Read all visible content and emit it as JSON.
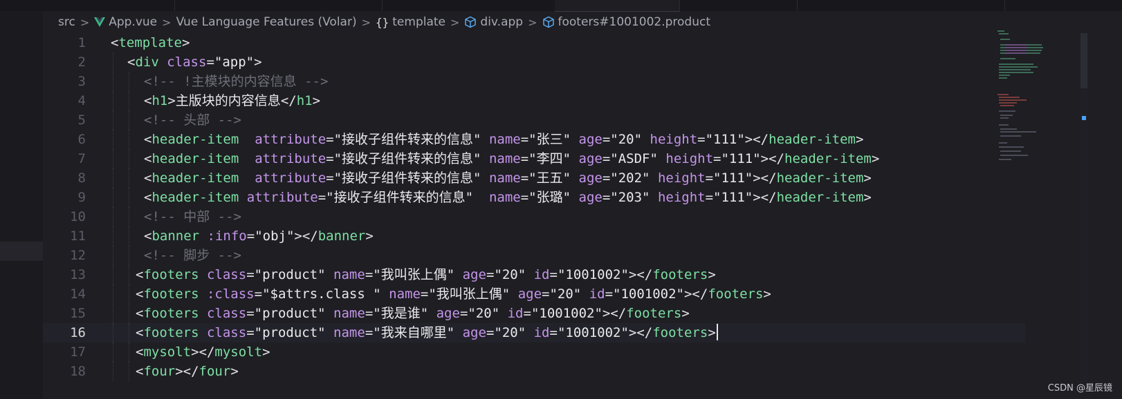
{
  "breadcrumb": {
    "items": [
      {
        "label": "src",
        "icon": null
      },
      {
        "label": "App.vue",
        "icon": "vue-logo-icon"
      },
      {
        "label": "Vue Language Features (Volar)",
        "icon": null
      },
      {
        "label": "template",
        "icon": "braces-icon"
      },
      {
        "label": "div.app",
        "icon": "cube-icon"
      },
      {
        "label": "footers#1001002.product",
        "icon": "cube-icon"
      }
    ],
    "separator": ">"
  },
  "editor": {
    "current_line": 16,
    "lines": [
      {
        "n": "1"
      },
      {
        "n": "2"
      },
      {
        "n": "3"
      },
      {
        "n": "4"
      },
      {
        "n": "5"
      },
      {
        "n": "6"
      },
      {
        "n": "7"
      },
      {
        "n": "8"
      },
      {
        "n": "9"
      },
      {
        "n": "10"
      },
      {
        "n": "11"
      },
      {
        "n": "12"
      },
      {
        "n": "13"
      },
      {
        "n": "14"
      },
      {
        "n": "15"
      },
      {
        "n": "16"
      },
      {
        "n": "17"
      },
      {
        "n": "18"
      }
    ],
    "code": {
      "l1_tag": "template",
      "l2_tag": "div",
      "l2_attr": "class",
      "l2_val": "\"app\"",
      "l3_comment": "<!-- !主模块的内容信息 -->",
      "l4_tag": "h1",
      "l4_text": "主版块的内容信息",
      "l5_comment": "<!-- 头部 -->",
      "l6": {
        "tag": "header-item",
        "a1": "attribute",
        "v1": "\"接收子组件转来的信息\"",
        "a2": "name",
        "v2": "\"张三\"",
        "a3": "age",
        "v3": "\"20\"",
        "a4": "height",
        "v4": "\"111\""
      },
      "l7": {
        "tag": "header-item",
        "a1": "attribute",
        "v1": "\"接收子组件转来的信息\"",
        "a2": "name",
        "v2": "\"李四\"",
        "a3": "age",
        "v3": "\"ASDF\"",
        "a4": "height",
        "v4": "\"111\""
      },
      "l8": {
        "tag": "header-item",
        "a1": "attribute",
        "v1": "\"接收子组件转来的信息\"",
        "a2": "name",
        "v2": "\"王五\"",
        "a3": "age",
        "v3": "\"202\"",
        "a4": "height",
        "v4": "\"111\""
      },
      "l9": {
        "tag": "header-item",
        "a1": "attribute",
        "v1": "\"接收子组件转来的信息\"",
        "a2": "name",
        "v2": "\"张璐\"",
        "a3": "age",
        "v3": "\"203\"",
        "a4": "height",
        "v4": "\"111\""
      },
      "l10_comment": "<!-- 中部 -->",
      "l11_tag": "banner",
      "l11_attr": ":info",
      "l11_val": "\"obj\"",
      "l12_comment": "<!-- 脚步 -->",
      "l13": {
        "tag": "footers",
        "a1": "class",
        "v1": "\"product\"",
        "a2": "name",
        "v2": "\"我叫张上偶\"",
        "a3": "age",
        "v3": "\"20\"",
        "a4": "id",
        "v4": "\"1001002\""
      },
      "l14": {
        "tag": "footers",
        "a1": ":class",
        "v1": "\"$attrs.class \"",
        "a2": "name",
        "v2": "\"我叫张上偶\"",
        "a3": "age",
        "v3": "\"20\"",
        "a4": "id",
        "v4": "\"1001002\""
      },
      "l15": {
        "tag": "footers",
        "a1": "class",
        "v1": "\"product\"",
        "a2": "name",
        "v2": "\"我是谁\"",
        "a3": "age",
        "v3": "\"20\"",
        "a4": "id",
        "v4": "\"1001002\""
      },
      "l16": {
        "tag": "footers",
        "a1": "class",
        "v1": "\"product\"",
        "a2": "name",
        "v2": "\"我来自哪里\"",
        "a3": "age",
        "v3": "\"20\"",
        "a4": "id",
        "v4": "\"1001002\""
      },
      "l17_tag": "mysolt",
      "l18_tag": "four"
    }
  },
  "watermark": "CSDN @星辰镜",
  "colors": {
    "background": "#1e1e23",
    "tag": "#7ee0a3",
    "attribute": "#c595ea",
    "string": "#eaeaee",
    "comment": "#6e6e78",
    "line_number": "#5c5c66",
    "vue_green": "#41b883",
    "cube_blue": "#5aa9f0"
  }
}
